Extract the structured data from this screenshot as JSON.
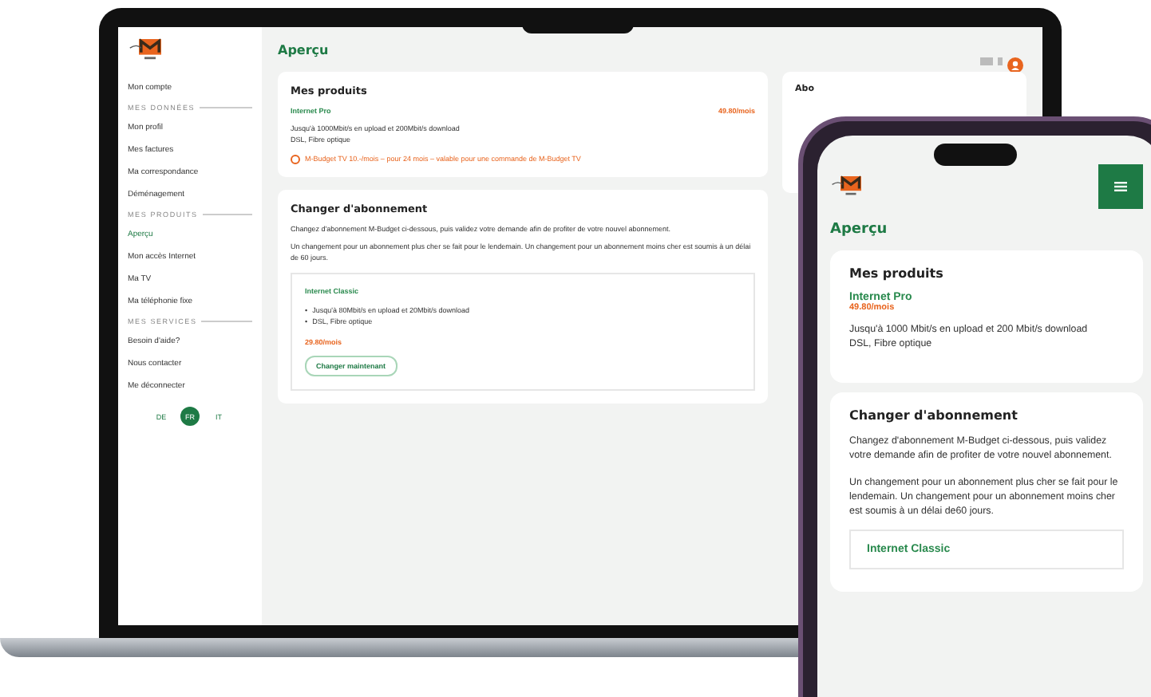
{
  "laptop": {
    "sidebar": {
      "items": [
        {
          "kind": "link",
          "label": "Mon compte",
          "selected": false
        },
        {
          "kind": "section",
          "label": "MES DONNÉES",
          "selected": false
        },
        {
          "kind": "link",
          "label": "Mon profil",
          "selected": false
        },
        {
          "kind": "link",
          "label": "Mes factures",
          "selected": false
        },
        {
          "kind": "link",
          "label": "Ma correspondance",
          "selected": false
        },
        {
          "kind": "link",
          "label": "Déménagement",
          "selected": false
        },
        {
          "kind": "section",
          "label": "MES PRODUITS",
          "selected": false
        },
        {
          "kind": "link",
          "label": "Aperçu",
          "selected": true
        },
        {
          "kind": "link",
          "label": "Mon accès Internet",
          "selected": false
        },
        {
          "kind": "link",
          "label": "Ma TV",
          "selected": false
        },
        {
          "kind": "link",
          "label": "Ma téléphonie fixe",
          "selected": false
        },
        {
          "kind": "section",
          "label": "MES SERVICES",
          "selected": false
        },
        {
          "kind": "link",
          "label": "Besoin d'aide?",
          "selected": false
        },
        {
          "kind": "link",
          "label": "Nous contacter",
          "selected": false
        },
        {
          "kind": "link",
          "label": "Me déconnecter",
          "selected": false
        }
      ],
      "languages": [
        {
          "label": "DE",
          "selected": false
        },
        {
          "label": "FR",
          "selected": true
        },
        {
          "label": "IT",
          "selected": false
        }
      ]
    },
    "page_title": "Aperçu",
    "products_card": {
      "title": "Mes produits",
      "product": "Internet Pro",
      "price": "49.80/mois",
      "details": [
        "Jusqu'à 1000Mbit/s en upload et 200Mbit/s download",
        "DSL, Fibre optique"
      ],
      "promo": "M-Budget TV 10.-/mois – pour 24 mois – valable pour une commande de M-Budget TV"
    },
    "change_card": {
      "title": "Changer d'abonnement",
      "paragraphs": [
        "Changez d'abonnement M-Budget ci-dessous, puis validez votre demande afin de profiter de votre nouvel abonnement.",
        "Un changement pour un abonnement plus cher se fait pour le lendemain. Un changement pour un abonnement moins cher est soumis à un délai de 60 jours."
      ],
      "plan": {
        "name": "Internet Classic",
        "bullet": "•",
        "features": [
          "Jusqu'à 80Mbit/s en upload et 20Mbit/s download",
          "DSL, Fibre optique"
        ],
        "price": "29.80/mois",
        "button": "Changer maintenant"
      }
    },
    "side_card": {
      "title": "Abo"
    }
  },
  "phone": {
    "page_title": "Aperçu",
    "products_card": {
      "title": "Mes produits",
      "product": "Internet Pro",
      "price": "49.80/mois",
      "details": [
        "Jusqu'à 1000 Mbit/s en upload et 200 Mbit/s download",
        "DSL, Fibre optique"
      ]
    },
    "change_card": {
      "title": "Changer d'abonnement",
      "paragraphs": [
        "Changez d'abonnement M-Budget ci-dessous, puis validez votre demande afin de profiter de votre nouvel abonnement.",
        "Un changement pour un abonnement plus cher se fait pour le lendemain. Un changement pour un abonnement moins cher est soumis à un délai de60 jours."
      ],
      "plan": {
        "name": "Internet Classic"
      }
    }
  }
}
